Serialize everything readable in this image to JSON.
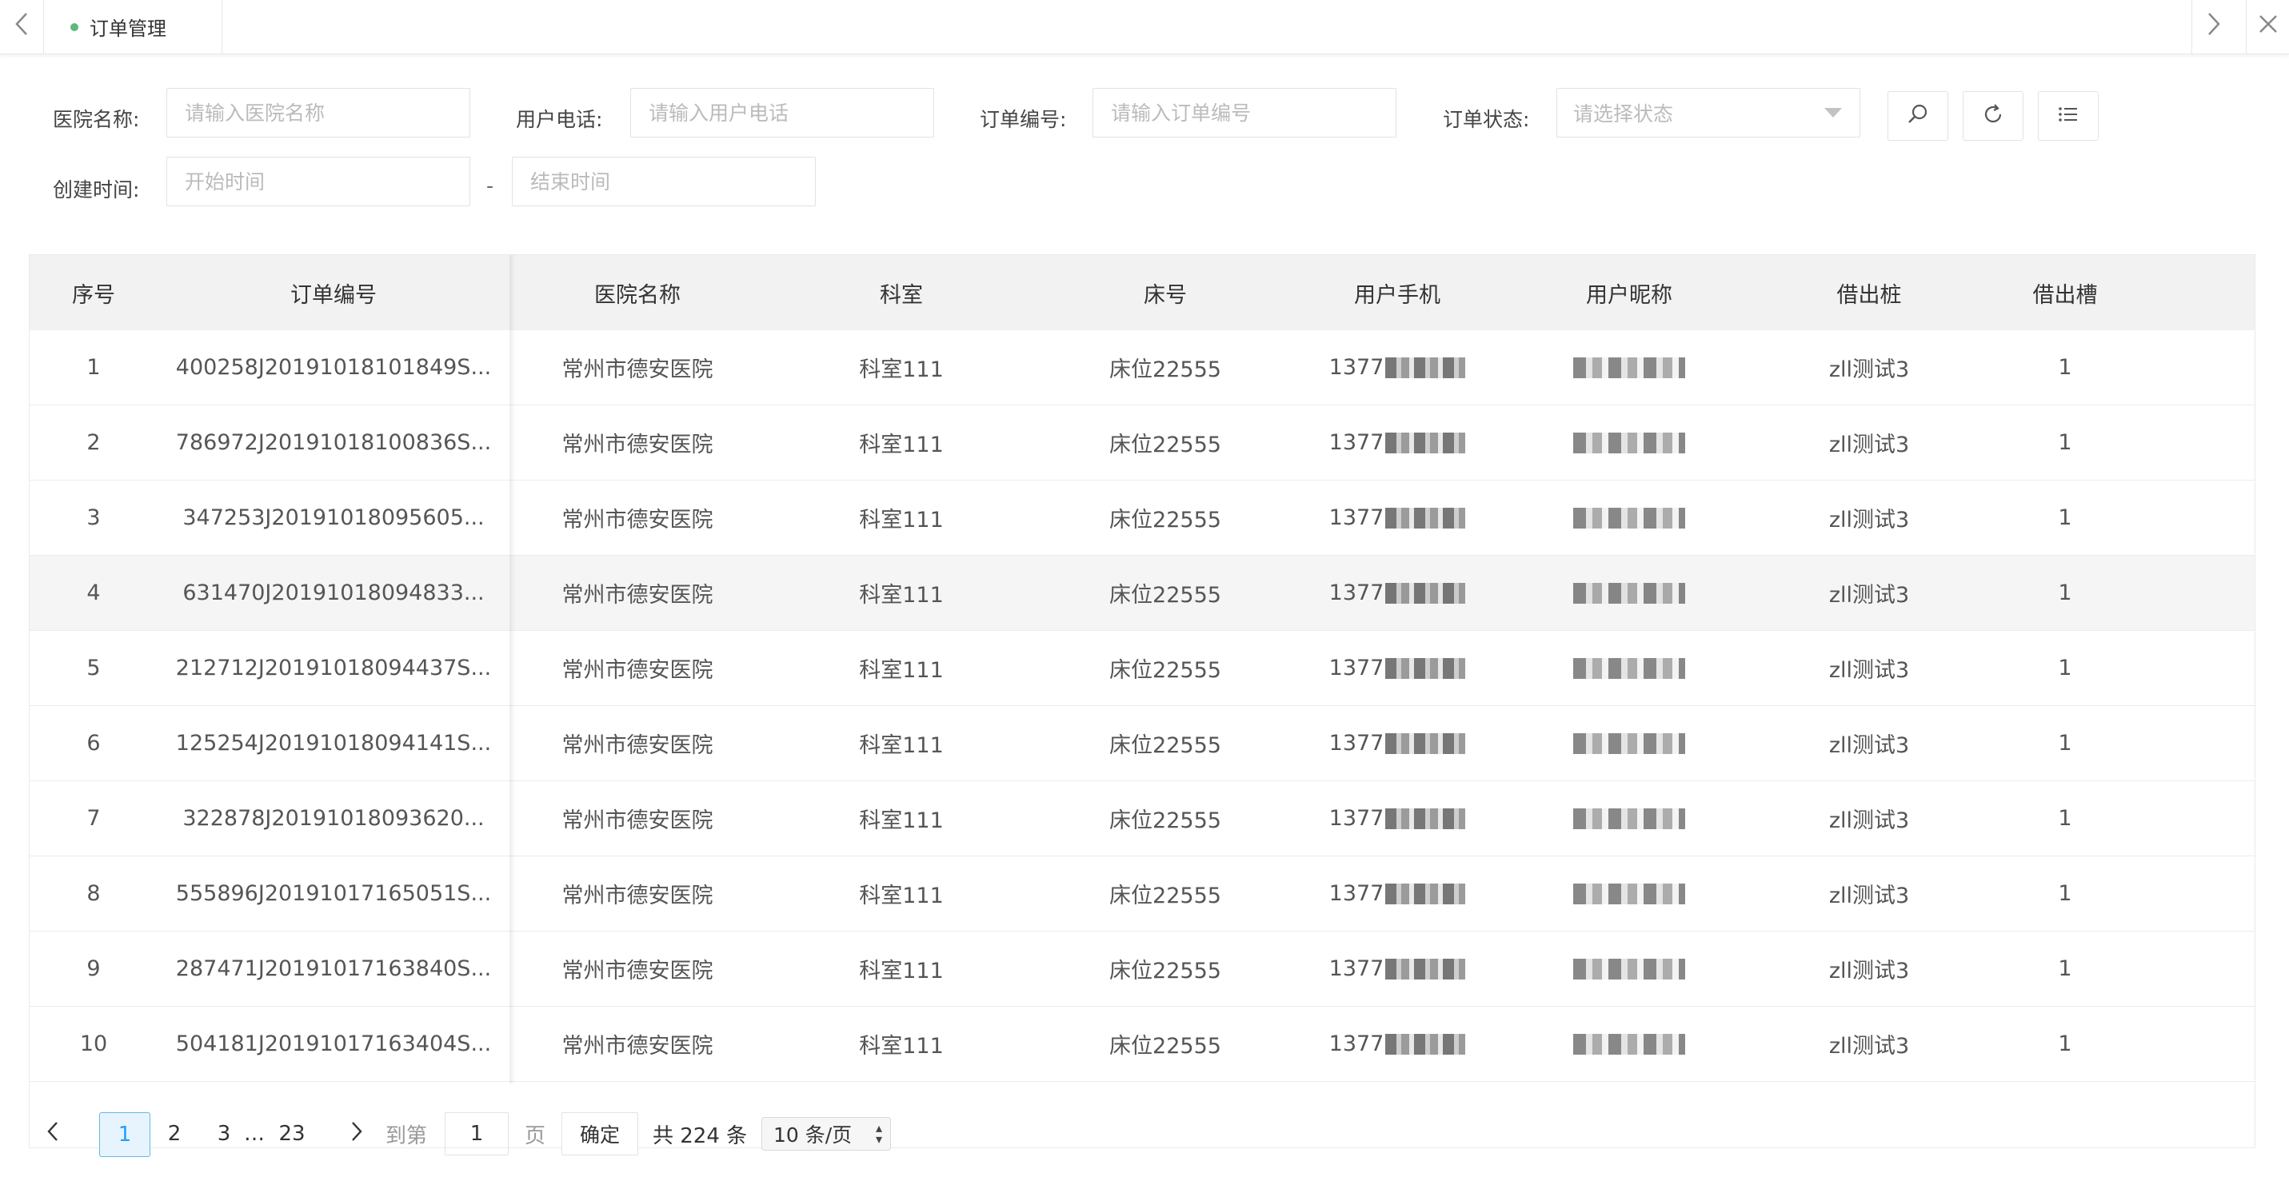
{
  "tabs": {
    "active_label": "订单管理",
    "prev_icon": "chevron-left-icon",
    "next_icon": "chevron-right-icon",
    "close_icon": "close-icon"
  },
  "filters": {
    "hospital": {
      "label": "医院名称:",
      "placeholder": "请输入医院名称"
    },
    "phone": {
      "label": "用户电话:",
      "placeholder": "请输入用户电话"
    },
    "order_no": {
      "label": "订单编号:",
      "placeholder": "请输入订单编号"
    },
    "status": {
      "label": "订单状态:",
      "placeholder": "请选择状态"
    },
    "created": {
      "label": "创建时间:",
      "start_placeholder": "开始时间",
      "end_placeholder": "结束时间",
      "separator": "-"
    },
    "buttons": [
      "search-icon",
      "refresh-icon",
      "list-icon"
    ]
  },
  "table": {
    "headers": [
      "序号",
      "订单编号",
      "医院名称",
      "科室",
      "床号",
      "用户手机",
      "用户昵称",
      "借出桩",
      "借出槽"
    ],
    "rows": [
      {
        "idx": "1",
        "order": "400258J20191018101849S...",
        "hospital": "常州市德安医院",
        "dept": "科室111",
        "bed": "床位22555",
        "phone": "1377",
        "pile": "zll测试3",
        "slot": "1"
      },
      {
        "idx": "2",
        "order": "786972J20191018100836S...",
        "hospital": "常州市德安医院",
        "dept": "科室111",
        "bed": "床位22555",
        "phone": "1377",
        "pile": "zll测试3",
        "slot": "1"
      },
      {
        "idx": "3",
        "order": "347253J20191018095605...",
        "hospital": "常州市德安医院",
        "dept": "科室111",
        "bed": "床位22555",
        "phone": "1377",
        "pile": "zll测试3",
        "slot": "1"
      },
      {
        "idx": "4",
        "order": "631470J20191018094833...",
        "hospital": "常州市德安医院",
        "dept": "科室111",
        "bed": "床位22555",
        "phone": "1377",
        "pile": "zll测试3",
        "slot": "1"
      },
      {
        "idx": "5",
        "order": "212712J20191018094437S...",
        "hospital": "常州市德安医院",
        "dept": "科室111",
        "bed": "床位22555",
        "phone": "1377",
        "pile": "zll测试3",
        "slot": "1"
      },
      {
        "idx": "6",
        "order": "125254J20191018094141S...",
        "hospital": "常州市德安医院",
        "dept": "科室111",
        "bed": "床位22555",
        "phone": "1377",
        "pile": "zll测试3",
        "slot": "1"
      },
      {
        "idx": "7",
        "order": "322878J20191018093620...",
        "hospital": "常州市德安医院",
        "dept": "科室111",
        "bed": "床位22555",
        "phone": "1377",
        "pile": "zll测试3",
        "slot": "1"
      },
      {
        "idx": "8",
        "order": "555896J20191017165051S...",
        "hospital": "常州市德安医院",
        "dept": "科室111",
        "bed": "床位22555",
        "phone": "1377",
        "pile": "zll测试3",
        "slot": "1"
      },
      {
        "idx": "9",
        "order": "287471J20191017163840S...",
        "hospital": "常州市德安医院",
        "dept": "科室111",
        "bed": "床位22555",
        "phone": "1377",
        "pile": "zll测试3",
        "slot": "1"
      },
      {
        "idx": "10",
        "order": "504181J20191017163404S...",
        "hospital": "常州市德安医院",
        "dept": "科室111",
        "bed": "床位22555",
        "phone": "1377",
        "pile": "zll测试3",
        "slot": "1"
      }
    ],
    "hovered_row": 4
  },
  "pagination": {
    "pages": [
      "1",
      "2",
      "3",
      "…",
      "23"
    ],
    "current": "1",
    "goto_label": "到第",
    "goto_value": "1",
    "page_unit": "页",
    "confirm_label": "确定",
    "total_label": "共 224 条",
    "page_size_label": "10 条/页"
  },
  "colors": {
    "accent": "#1e9fff",
    "tab_dot": "#5fb878",
    "header_bg": "#f2f2f2"
  }
}
